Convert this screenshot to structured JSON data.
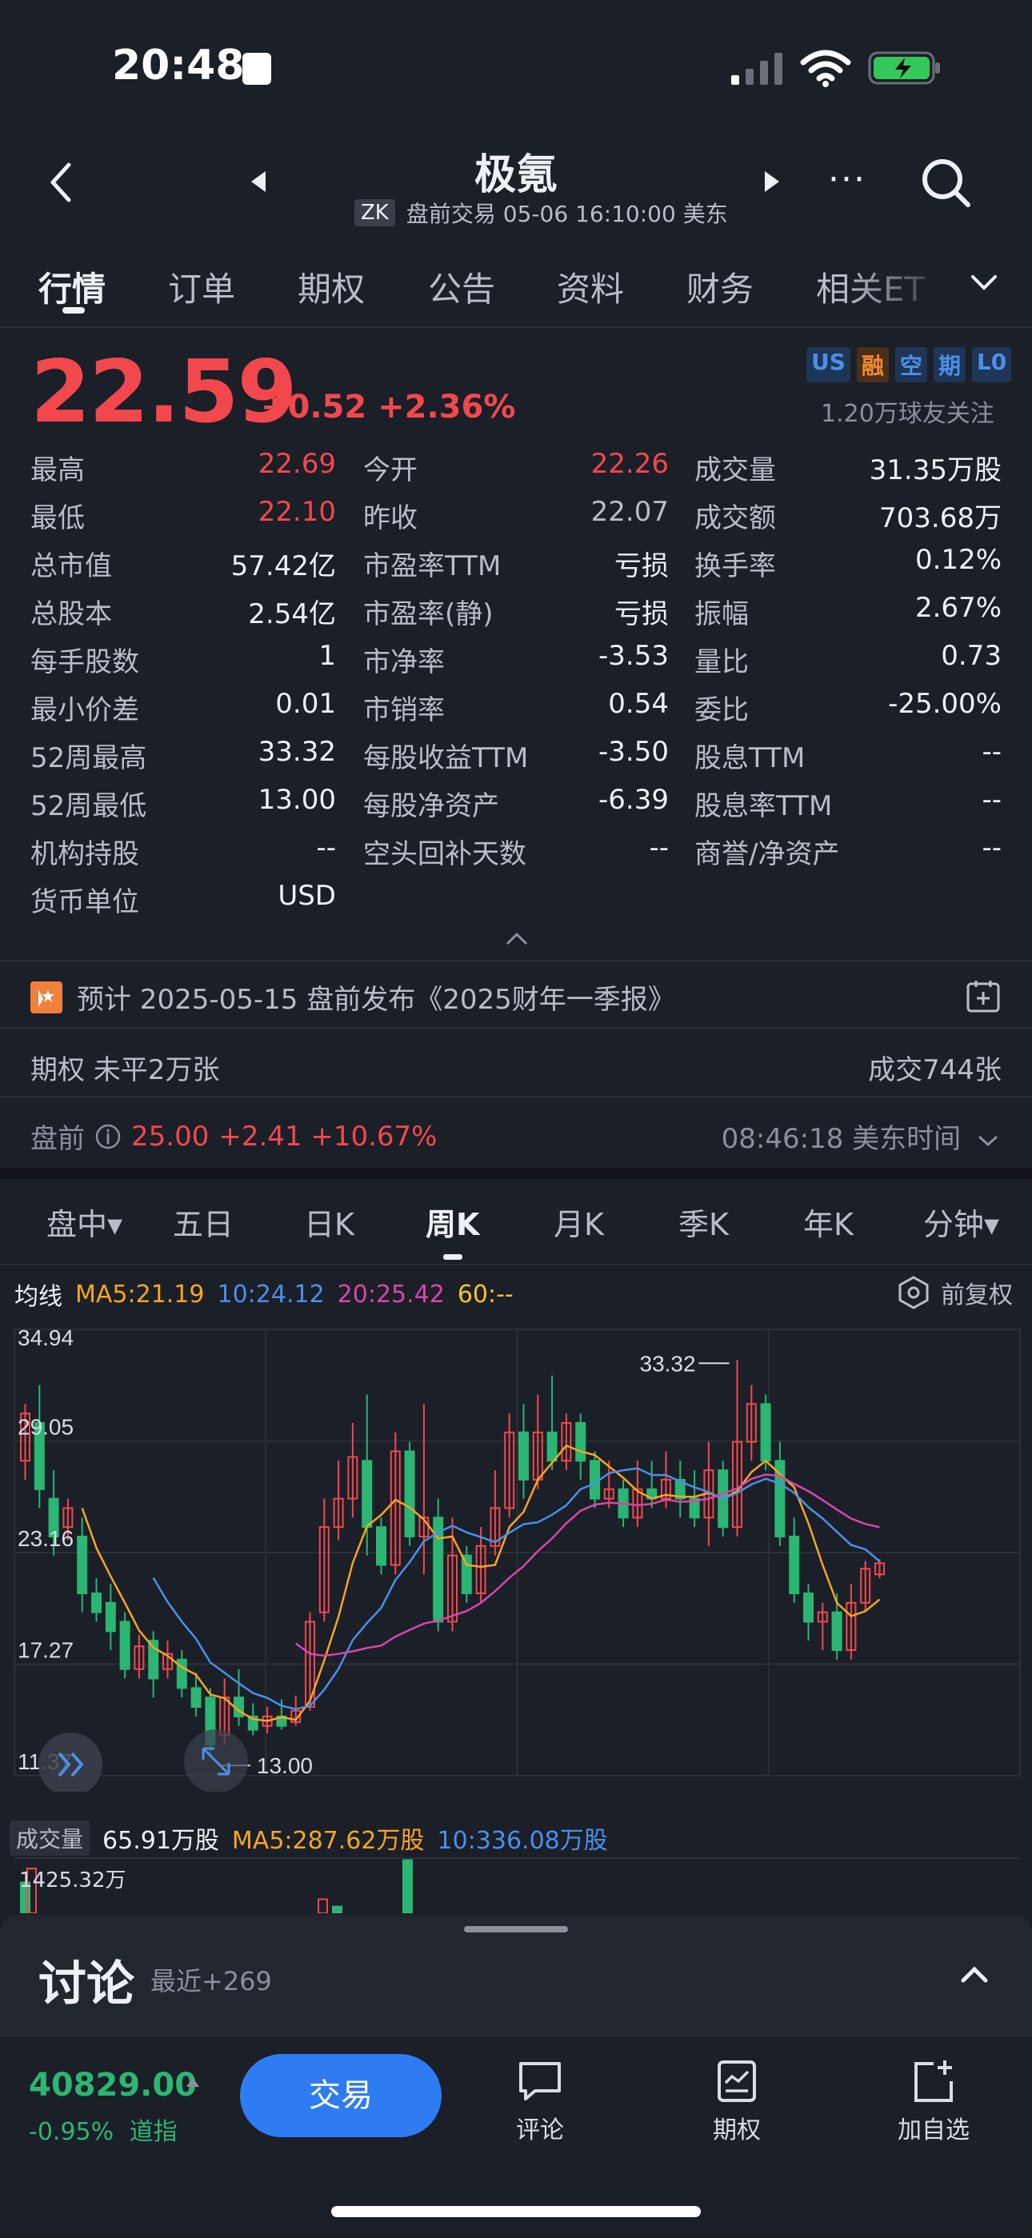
{
  "status_bar": {
    "time": "20:48"
  },
  "header": {
    "title": "极氪",
    "ticker_badge": "ZK",
    "session_info": "盘前交易 05-06 16:10:00 美东"
  },
  "tabs": [
    "行情",
    "订单",
    "期权",
    "公告",
    "资料",
    "财务",
    "相关ET"
  ],
  "quote": {
    "price": "22.59",
    "change": "+0.52 +2.36%",
    "badges": [
      "US",
      "融",
      "空",
      "期",
      "L0"
    ],
    "followers": "1.20万球友关注"
  },
  "stats": [
    [
      {
        "label": "最高",
        "value": "22.69",
        "color": "red"
      },
      {
        "label": "今开",
        "value": "22.26",
        "color": "red"
      },
      {
        "label": "成交量",
        "value": "31.35万股",
        "color": "white"
      }
    ],
    [
      {
        "label": "最低",
        "value": "22.10",
        "color": "red"
      },
      {
        "label": "昨收",
        "value": "22.07",
        "color": "gray"
      },
      {
        "label": "成交额",
        "value": "703.68万",
        "color": "white"
      }
    ],
    [
      {
        "label": "总市值",
        "value": "57.42亿",
        "color": "white"
      },
      {
        "label": "市盈率TTM",
        "value": "亏损",
        "color": "white"
      },
      {
        "label": "换手率",
        "value": "0.12%",
        "color": "white"
      }
    ],
    [
      {
        "label": "总股本",
        "value": "2.54亿",
        "color": "white"
      },
      {
        "label": "市盈率(静)",
        "value": "亏损",
        "color": "white"
      },
      {
        "label": "振幅",
        "value": "2.67%",
        "color": "white"
      }
    ],
    [
      {
        "label": "每手股数",
        "value": "1",
        "color": "white"
      },
      {
        "label": "市净率",
        "value": "-3.53",
        "color": "white"
      },
      {
        "label": "量比",
        "value": "0.73",
        "color": "white"
      }
    ],
    [
      {
        "label": "最小价差",
        "value": "0.01",
        "color": "white"
      },
      {
        "label": "市销率",
        "value": "0.54",
        "color": "white"
      },
      {
        "label": "委比",
        "value": "-25.00%",
        "color": "white"
      }
    ],
    [
      {
        "label": "52周最高",
        "value": "33.32",
        "color": "white"
      },
      {
        "label": "每股收益TTM",
        "value": "-3.50",
        "color": "white"
      },
      {
        "label": "股息TTM",
        "value": "--",
        "color": "white"
      }
    ],
    [
      {
        "label": "52周最低",
        "value": "13.00",
        "color": "white"
      },
      {
        "label": "每股净资产",
        "value": "-6.39",
        "color": "white"
      },
      {
        "label": "股息率TTM",
        "value": "--",
        "color": "white"
      }
    ],
    [
      {
        "label": "机构持股",
        "value": "--",
        "color": "white"
      },
      {
        "label": "空头回补天数",
        "value": "--",
        "color": "white"
      },
      {
        "label": "商誉/净资产",
        "value": "--",
        "color": "white"
      }
    ],
    [
      {
        "label": "货币单位",
        "value": "USD",
        "color": "white"
      }
    ]
  ],
  "event": {
    "text": "预计 2025-05-15 盘前发布《2025财年一季报》"
  },
  "options": {
    "left": "期权  未平2万张",
    "right": "成交744张"
  },
  "pre_market": {
    "label": "盘前",
    "price": "25.00",
    "change": "+2.41 +10.67%",
    "time": "08:46:18 美东时间"
  },
  "chart_tabs": [
    "盘中▾",
    "五日",
    "日K",
    "周K",
    "月K",
    "季K",
    "年K",
    "分钟▾"
  ],
  "ma": {
    "label": "均线",
    "ma5": "MA5:21.19",
    "ma10": "10:24.12",
    "ma20": "20:25.42",
    "ma60": "60:--",
    "adjust": "前复权"
  },
  "colors": {
    "up": "#f2484d",
    "down": "#2bb673",
    "ma5": "#f5a623",
    "ma10": "#4a90e8",
    "ma20": "#d946a8",
    "bg": "#1b1f28",
    "brand": "#2f7cf2"
  },
  "chart_data": {
    "type": "candlestick",
    "y_ticks": [
      "34.94",
      "29.05",
      "23.16",
      "17.27",
      "11.37"
    ],
    "ylim": [
      11.37,
      34.94
    ],
    "high_label": "33.32",
    "low_label": "13.00",
    "candles": [
      [
        28,
        30.5,
        27,
        31
      ],
      [
        30,
        26.5,
        25.5,
        32
      ],
      [
        26,
        24,
        23,
        27.5
      ],
      [
        24.5,
        25.5,
        23.8,
        26
      ],
      [
        24,
        21,
        20,
        25
      ],
      [
        21,
        20,
        19.5,
        21.8
      ],
      [
        20.5,
        19,
        18,
        21.5
      ],
      [
        19.5,
        17,
        16.5,
        20
      ],
      [
        17,
        18.2,
        16.5,
        18.8
      ],
      [
        18.5,
        16.5,
        15.5,
        19
      ],
      [
        17,
        17.8,
        16.5,
        18.5
      ],
      [
        17.5,
        16,
        15.5,
        18
      ],
      [
        16,
        15,
        14.5,
        16.8
      ],
      [
        15.5,
        13,
        12.5,
        16
      ],
      [
        13.5,
        15.5,
        13,
        16.5
      ],
      [
        15.5,
        14.5,
        14,
        17
      ],
      [
        14.5,
        13.8,
        13.5,
        15.2
      ],
      [
        14,
        14.5,
        13.6,
        15
      ],
      [
        14.5,
        14,
        13.8,
        15.4
      ],
      [
        14.2,
        14.8,
        14,
        15.6
      ],
      [
        15,
        19.5,
        14.8,
        20
      ],
      [
        20,
        24.5,
        19.5,
        26
      ],
      [
        24.5,
        26,
        23.8,
        28
      ],
      [
        26,
        28.2,
        25,
        30
      ],
      [
        28,
        24.5,
        23,
        31.5
      ],
      [
        24.5,
        22.5,
        22,
        25
      ],
      [
        22.5,
        28.5,
        22,
        29.5
      ],
      [
        28.5,
        24,
        23.5,
        29
      ],
      [
        24,
        25,
        22,
        31
      ],
      [
        25,
        19.5,
        19,
        26
      ],
      [
        19.5,
        23,
        19,
        25
      ],
      [
        23,
        21,
        20.5,
        23.5
      ],
      [
        21,
        23.5,
        20.5,
        24.5
      ],
      [
        23.5,
        25.5,
        23,
        27.5
      ],
      [
        25.5,
        29.5,
        25,
        30.5
      ],
      [
        29.5,
        27,
        26,
        31
      ],
      [
        27,
        29.5,
        26.5,
        31.5
      ],
      [
        29.5,
        28,
        27.5,
        32.5
      ],
      [
        28,
        30,
        27.5,
        30.5
      ],
      [
        30,
        28,
        27,
        30.5
      ],
      [
        28,
        26,
        25.5,
        28.5
      ],
      [
        26,
        26.5,
        25.5,
        28
      ],
      [
        26.5,
        25,
        24.5,
        27
      ],
      [
        25,
        26.5,
        24.5,
        28
      ],
      [
        26.5,
        26,
        25.5,
        28
      ],
      [
        26,
        27,
        25.5,
        28.5
      ],
      [
        27,
        26,
        25,
        28
      ],
      [
        26,
        25,
        24.5,
        27.5
      ],
      [
        25,
        27.5,
        23.5,
        29
      ],
      [
        27.5,
        24.5,
        24,
        28
      ],
      [
        24.5,
        29,
        24,
        33.32
      ],
      [
        29,
        31,
        28,
        32
      ],
      [
        31,
        28,
        27.5,
        31.5
      ],
      [
        28,
        24,
        23.5,
        29
      ],
      [
        24,
        21,
        20.5,
        25
      ],
      [
        21,
        19.5,
        18.5,
        21.5
      ],
      [
        19.5,
        20,
        18,
        20.5
      ],
      [
        20,
        18,
        17.5,
        21
      ],
      [
        18,
        20.5,
        17.5,
        21.5
      ],
      [
        20.5,
        22.3,
        20,
        22.7
      ],
      [
        22,
        22.59,
        21.8,
        22.8
      ]
    ]
  },
  "volume": {
    "label": "成交量",
    "value": "65.91万股",
    "ma5": "MA5:287.62万股",
    "ma10": "10:336.08万股",
    "max": "1425.32万"
  },
  "discussion": {
    "title": "讨论",
    "recent": "最近+269"
  },
  "bottom_bar": {
    "index_value": "40829.00",
    "index_change": "-0.95%",
    "index_name": "道指",
    "trade": "交易",
    "nav": [
      "评论",
      "期权",
      "加自选"
    ]
  }
}
